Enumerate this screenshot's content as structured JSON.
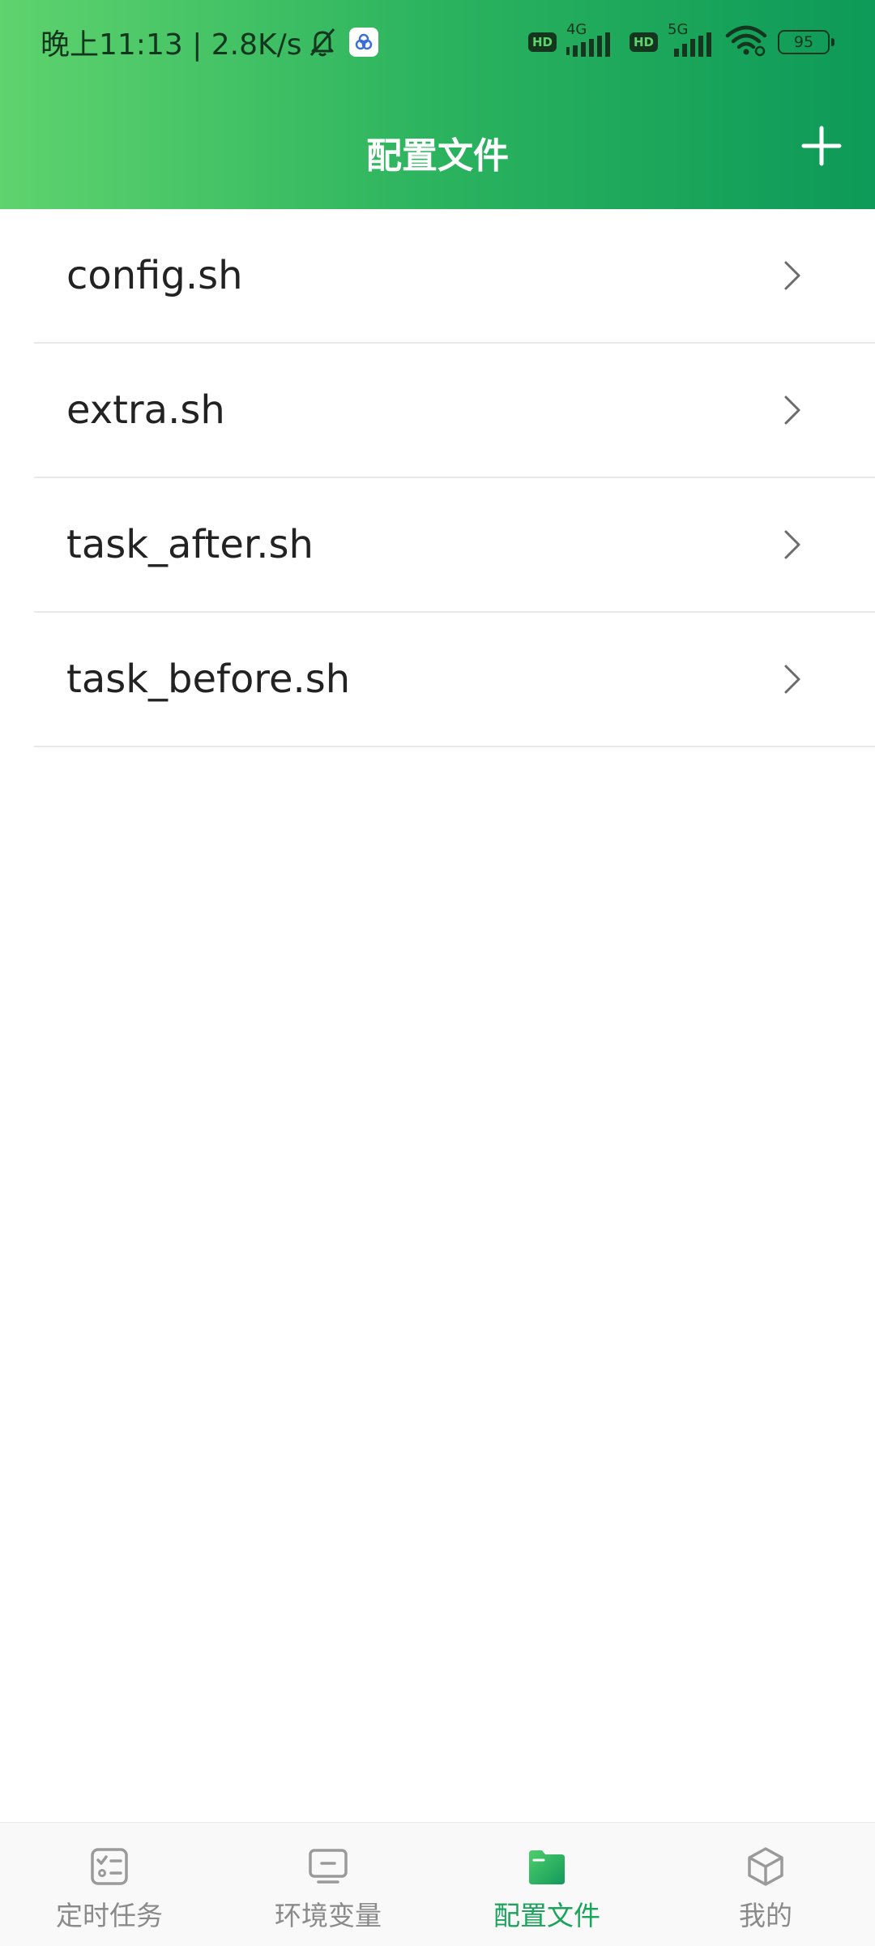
{
  "status_bar": {
    "time_speed": "晚上11:13 | 2.8K/s",
    "hd_1": "HD",
    "network_1": "4G",
    "hd_2": "HD",
    "network_2": "5G",
    "battery": "95"
  },
  "header": {
    "title": "配置文件",
    "add_label": "+"
  },
  "files": [
    {
      "name": "config.sh"
    },
    {
      "name": "extra.sh"
    },
    {
      "name": "task_after.sh"
    },
    {
      "name": "task_before.sh"
    }
  ],
  "tabs": [
    {
      "label": "定时任务",
      "icon": "task-list-icon",
      "active": false
    },
    {
      "label": "环境变量",
      "icon": "monitor-icon",
      "active": false
    },
    {
      "label": "配置文件",
      "icon": "folder-icon",
      "active": true
    },
    {
      "label": "我的",
      "icon": "cube-icon",
      "active": false
    }
  ],
  "colors": {
    "header_gradient_start": "#5fd36e",
    "header_gradient_end": "#0d9a58",
    "active_tab": "#1aa35a",
    "inactive_tab": "#8a8a8a"
  }
}
